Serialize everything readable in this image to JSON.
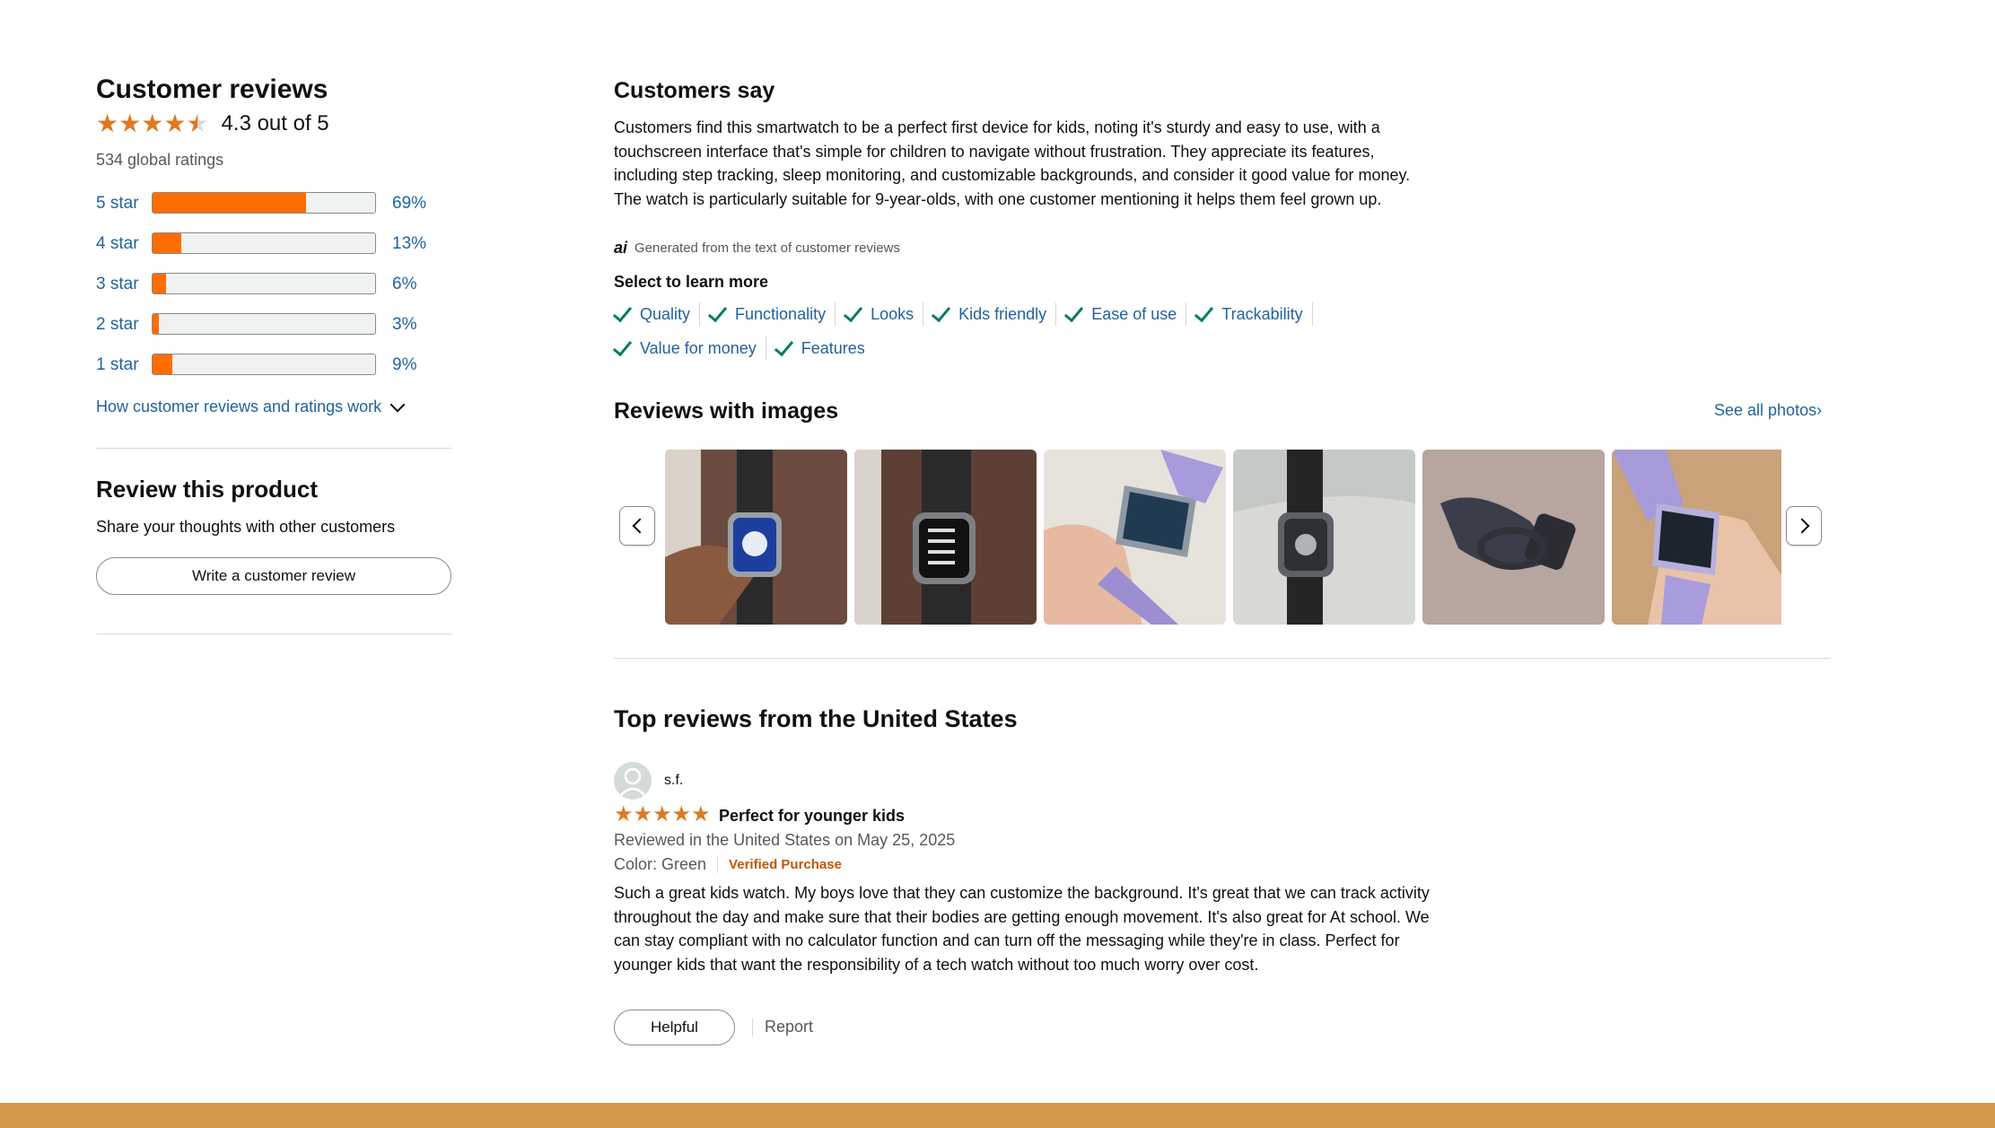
{
  "summary_panel": {
    "title": "Customer reviews",
    "rating_text": "4.3 out of 5",
    "stars": 4.3,
    "global_ratings": "534 global ratings",
    "histogram": [
      {
        "label": "5 star",
        "percent_text": "69%",
        "percent": 69
      },
      {
        "label": "4 star",
        "percent_text": "13%",
        "percent": 13
      },
      {
        "label": "3 star",
        "percent_text": "6%",
        "percent": 6
      },
      {
        "label": "2 star",
        "percent_text": "3%",
        "percent": 3
      },
      {
        "label": "1 star",
        "percent_text": "9%",
        "percent": 9
      }
    ],
    "how_link": "How customer reviews and ratings work",
    "review_product_title": "Review this product",
    "share_text": "Share your thoughts with other customers",
    "write_review_button": "Write a customer review"
  },
  "customers_say": {
    "title": "Customers say",
    "summary": "Customers find this smartwatch to be a perfect first device for kids, noting it's sturdy and easy to use, with a touchscreen interface that's simple for children to navigate without frustration. They appreciate its features, including step tracking, sleep monitoring, and customizable backgrounds, and consider it good value for money. The watch is particularly suitable for 9-year-olds, with one customer mentioning it helps them feel grown up.",
    "ai_badge": "ai",
    "ai_note": "Generated from the text of customer reviews",
    "select_label": "Select to learn more",
    "aspects": [
      "Quality",
      "Functionality",
      "Looks",
      "Kids friendly",
      "Ease of use",
      "Trackability",
      "Value for money",
      "Features"
    ]
  },
  "reviews_with_images": {
    "title": "Reviews with images",
    "see_all": "See all photos",
    "see_all_chevron": "›",
    "thumbnails": [
      "watch-in-hand-blue-face",
      "watch-on-carpet-menu",
      "purple-watch-in-hand",
      "black-watch-on-marble",
      "black-watch-on-rug",
      "purple-watch-hand"
    ]
  },
  "top_reviews": {
    "title": "Top reviews from the United States",
    "review": {
      "author": "s.f.",
      "stars": 5,
      "headline": "Perfect for younger kids",
      "date": "Reviewed in the United States on May 25, 2025",
      "color": "Color: Green",
      "verified": "Verified Purchase",
      "body": "Such a great kids watch. My boys love that they can customize the background. It's great that we can track activity throughout the day and make sure that their bodies are getting enough movement. It's also great for At school. We can stay compliant with no calculator function and can turn off the messaging while they're in class. Perfect for younger kids that want the responsibility of a tech watch without too much worry over cost.",
      "helpful_button": "Helpful",
      "report_link": "Report"
    }
  },
  "colors": {
    "star": "#de7921",
    "bar_fill": "#ff6d00",
    "link": "#2162a1",
    "check": "#067d62",
    "verified": "#c45500",
    "footer": "#d6984a"
  }
}
